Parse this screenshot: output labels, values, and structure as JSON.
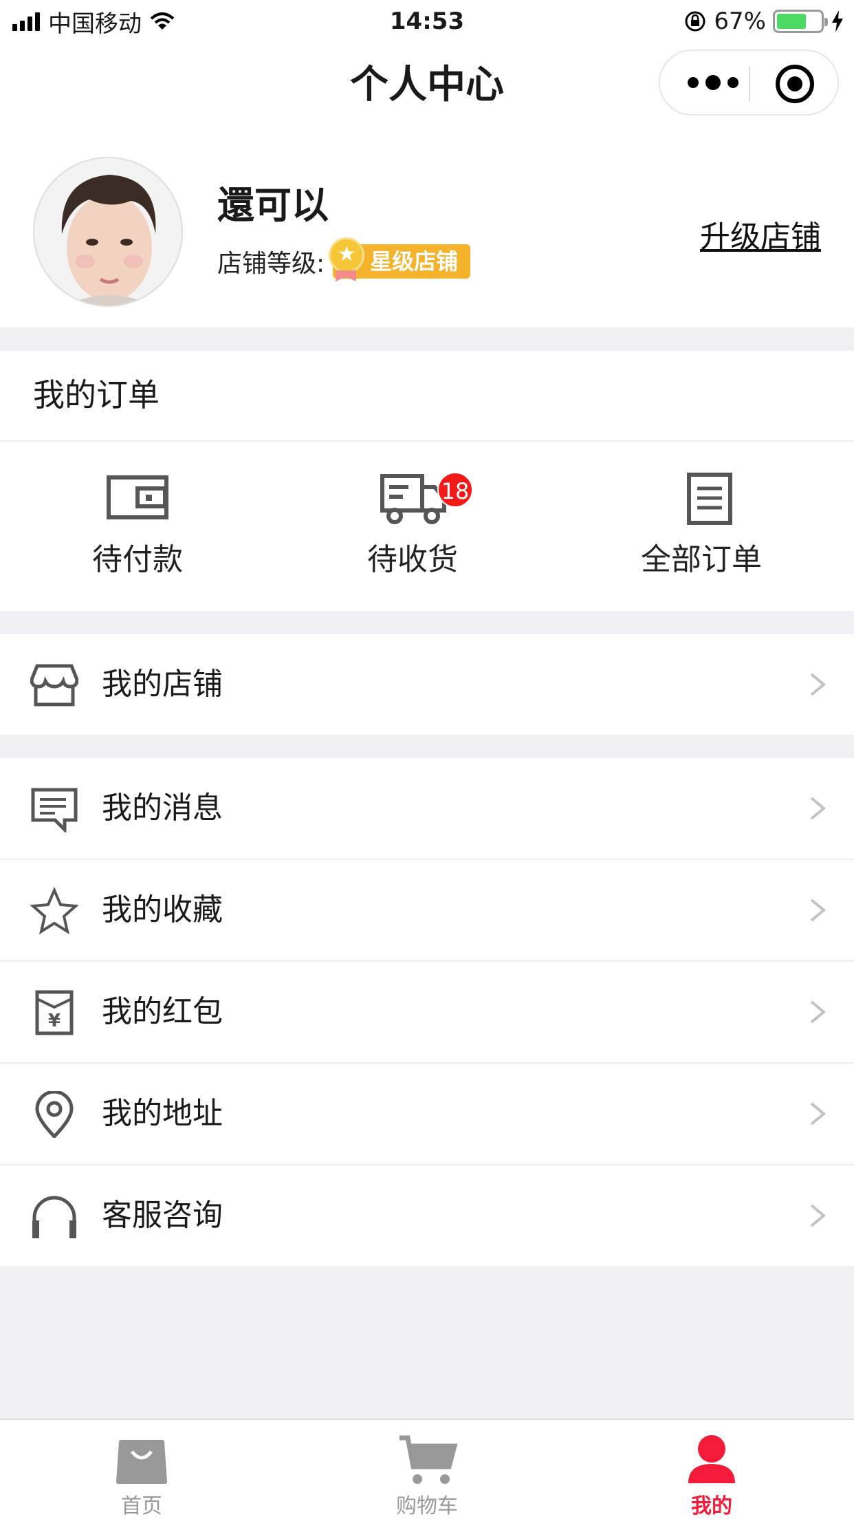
{
  "status_bar": {
    "carrier": "中国移动",
    "time": "14:53",
    "battery": "67%",
    "battery_level": 0.67
  },
  "nav": {
    "title": "个人中心"
  },
  "profile": {
    "username": "還可以",
    "level_label": "店铺等级:",
    "level_badge": "星级店铺",
    "upgrade_link": "升级店铺"
  },
  "orders": {
    "title": "我的订单",
    "items": [
      {
        "label": "待付款",
        "icon": "wallet-icon"
      },
      {
        "label": "待收货",
        "icon": "truck-icon",
        "badge": "18"
      },
      {
        "label": "全部订单",
        "icon": "document-icon"
      }
    ]
  },
  "menu": [
    {
      "label": "我的店铺",
      "icon": "store-icon"
    },
    {
      "label": "我的消息",
      "icon": "message-icon"
    },
    {
      "label": "我的收藏",
      "icon": "star-icon"
    },
    {
      "label": "我的红包",
      "icon": "red-packet-icon"
    },
    {
      "label": "我的地址",
      "icon": "location-icon"
    },
    {
      "label": "客服咨询",
      "icon": "headset-icon"
    }
  ],
  "tabbar": [
    {
      "label": "首页",
      "icon": "bag-icon",
      "active": false
    },
    {
      "label": "购物车",
      "icon": "cart-icon",
      "active": false
    },
    {
      "label": "我的",
      "icon": "user-icon",
      "active": true
    }
  ],
  "colors": {
    "accent": "#f41a3a",
    "badge_red": "#f41a1a",
    "level_gold": "#f4b32b",
    "battery_green": "#4cd964",
    "background": "#efeff4"
  }
}
